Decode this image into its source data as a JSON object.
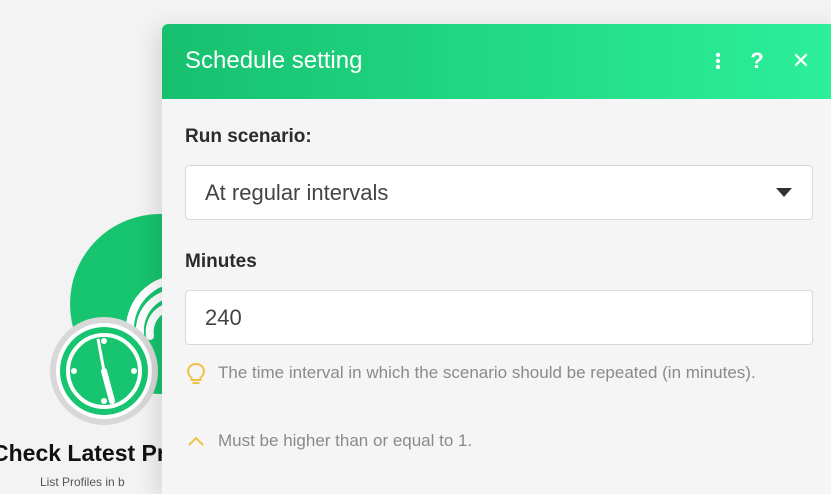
{
  "module": {
    "title": "Check Latest Pr",
    "subtitle": "List Profiles in b"
  },
  "dialog": {
    "title": "Schedule setting",
    "run_scenario_label": "Run scenario:",
    "run_scenario_value": "At regular intervals",
    "minutes_label": "Minutes",
    "minutes_value": "240",
    "hint_text": "The time interval in which the scenario should be repeated (in minutes).",
    "validation_text": "Must be higher than or equal to 1.",
    "help_glyph": "?",
    "close_glyph": "✕"
  },
  "colors": {
    "header_start": "#17c06f",
    "header_end": "#2cf09a",
    "module_green": "#17c46f",
    "hint_icon": "#f0c24b"
  },
  "icons": [
    "more-vertical-icon",
    "help-icon",
    "close-icon",
    "caret-down-icon",
    "lightbulb-icon",
    "chevron-up-icon",
    "clock-icon",
    "wifi-icon"
  ]
}
